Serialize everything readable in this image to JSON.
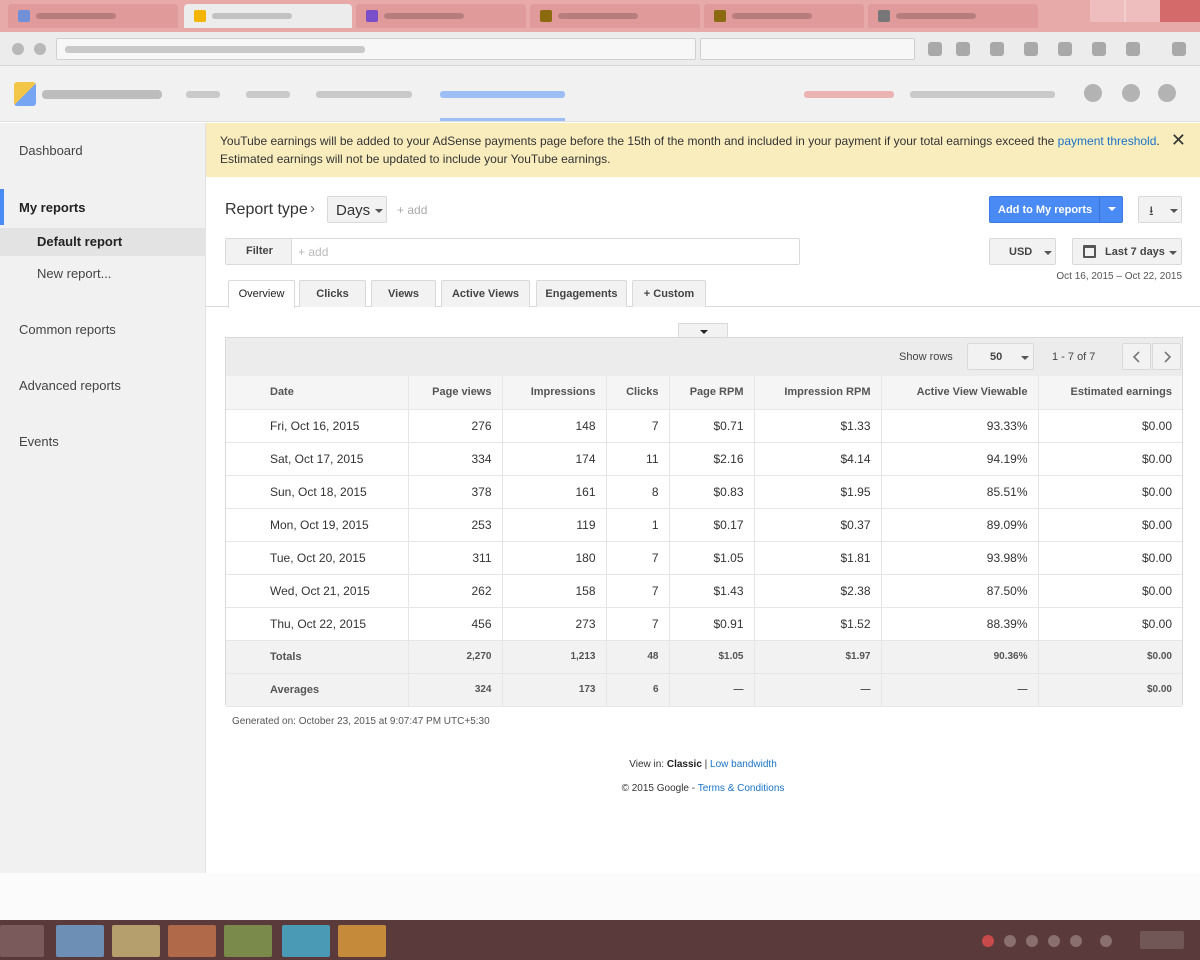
{
  "colors": {
    "accent_blue": "#4a8af4",
    "link_blue": "#1a73c8",
    "notice_bg": "#f9edbe",
    "sidebar_bg": "#f1f1f1"
  },
  "sidebar": {
    "items": [
      {
        "label": "Dashboard"
      },
      {
        "label": "My reports"
      },
      {
        "label": "Default report"
      },
      {
        "label": "New report..."
      },
      {
        "label": "Common reports"
      },
      {
        "label": "Advanced reports"
      },
      {
        "label": "Events"
      }
    ]
  },
  "notice": {
    "text_before": "YouTube earnings will be added to your AdSense payments page before the 15th of the month and included in your payment if your total earnings exceed the ",
    "link": "payment threshold",
    "text_after": ". Estimated earnings will not be updated to include your YouTube earnings.",
    "close_label": "✕"
  },
  "report_header": {
    "report_type_label": "Report type",
    "chevron": "›",
    "dimension": "Days",
    "add_label": "+ add",
    "add_to_reports_label": "Add to My reports",
    "download_icon": "⭳"
  },
  "filter": {
    "button_label": "Filter",
    "placeholder": "+ add"
  },
  "currency": {
    "value": "USD"
  },
  "date_range": {
    "label": "Last 7 days",
    "range_text": "Oct 16, 2015 – Oct 22, 2015"
  },
  "tabs": [
    {
      "label": "Overview",
      "active": true
    },
    {
      "label": "Clicks"
    },
    {
      "label": "Views"
    },
    {
      "label": "Active Views"
    },
    {
      "label": "Engagements"
    },
    {
      "label": "+  Custom"
    }
  ],
  "table_toolbar": {
    "show_rows_label": "Show rows",
    "show_rows_value": "50",
    "page_range": "1 - 7 of 7"
  },
  "table": {
    "columns": [
      "Date",
      "Page views",
      "Impressions",
      "Clicks",
      "Page RPM",
      "Impression RPM",
      "Active View Viewable",
      "Estimated earnings"
    ],
    "rows": [
      [
        "Fri, Oct 16, 2015",
        "276",
        "148",
        "7",
        "$0.71",
        "$1.33",
        "93.33%",
        "$0.00"
      ],
      [
        "Sat, Oct 17, 2015",
        "334",
        "174",
        "11",
        "$2.16",
        "$4.14",
        "94.19%",
        "$0.00"
      ],
      [
        "Sun, Oct 18, 2015",
        "378",
        "161",
        "8",
        "$0.83",
        "$1.95",
        "85.51%",
        "$0.00"
      ],
      [
        "Mon, Oct 19, 2015",
        "253",
        "119",
        "1",
        "$0.17",
        "$0.37",
        "89.09%",
        "$0.00"
      ],
      [
        "Tue, Oct 20, 2015",
        "311",
        "180",
        "7",
        "$1.05",
        "$1.81",
        "93.98%",
        "$0.00"
      ],
      [
        "Wed, Oct 21, 2015",
        "262",
        "158",
        "7",
        "$1.43",
        "$2.38",
        "87.50%",
        "$0.00"
      ],
      [
        "Thu, Oct 22, 2015",
        "456",
        "273",
        "7",
        "$0.91",
        "$1.52",
        "88.39%",
        "$0.00"
      ]
    ],
    "totals": [
      "Totals",
      "2,270",
      "1,213",
      "48",
      "$1.05",
      "$1.97",
      "90.36%",
      "$0.00"
    ],
    "averages": [
      "Averages",
      "324",
      "173",
      "6",
      "—",
      "—",
      "—",
      "$0.00"
    ]
  },
  "generated": "Generated on: October 23, 2015 at 9:07:47 PM UTC+5:30",
  "footer": {
    "view_in_label": "View in: ",
    "classic": "Classic",
    "separator": " | ",
    "low_bandwidth": "Low bandwidth",
    "copyright": "© 2015 Google - ",
    "terms": "Terms & Conditions"
  }
}
